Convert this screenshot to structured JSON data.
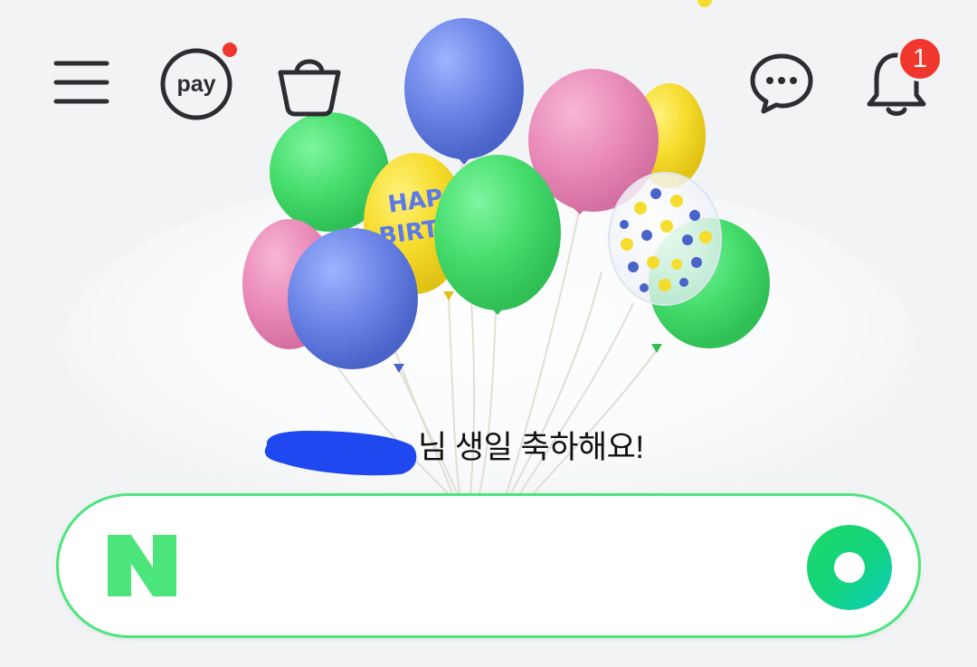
{
  "header": {
    "menu_icon": "hamburger-menu-icon",
    "pay_label": "pay",
    "pay_has_new": true,
    "shopping_icon": "shopping-bag-icon",
    "talk_icon": "chat-bubble-icon",
    "notification_icon": "bell-icon",
    "notification_count": "1"
  },
  "greeting": {
    "message_suffix": "님 생일 축하해요!",
    "name_redacted": true,
    "decoration": "birthday-balloons",
    "balloon_text": "HAPPY BIRTHDAY"
  },
  "search": {
    "logo_letter": "N",
    "placeholder": "",
    "value": "",
    "greendot_icon": "greendot-icon"
  },
  "colors": {
    "accent_green": "#4ce57b",
    "naver_green": "#03c75a",
    "badge_red": "#f1372d",
    "icon_dark": "#2b2d31",
    "background": "#f1f3f5"
  }
}
